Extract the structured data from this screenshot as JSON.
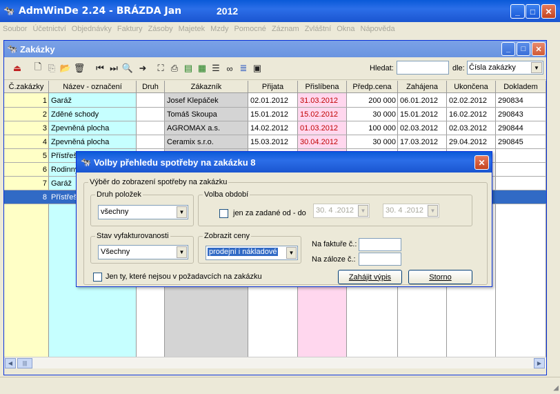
{
  "app": {
    "title": "AdmWinDe 2.24 - BRÁZDA Jan",
    "year": "2012",
    "icon": "app-icon"
  },
  "menu": [
    "Soubor",
    "Účetnictví",
    "Objednávky",
    "Faktury",
    "Zásoby",
    "Majetek",
    "Mzdy",
    "Pomocné",
    "Záznam",
    "Zvláštní",
    "Okna",
    "Nápověda"
  ],
  "child": {
    "title": "Zakázky",
    "search_label": "Hledat:",
    "search_value": "",
    "by_label": "dle:",
    "by_value": "Čísla zakázky"
  },
  "toolbar_icons": [
    "exit-icon",
    "new-icon",
    "copy-icon",
    "open-icon",
    "delete-icon",
    "first-icon",
    "last-icon",
    "find-icon",
    "next-icon",
    "select-icon",
    "print-icon",
    "export-icon",
    "excel-icon",
    "list-icon",
    "binoculars-icon",
    "tree-icon",
    "report-icon"
  ],
  "table": {
    "columns": [
      "Č.zakázky",
      "Název - označení",
      "Druh",
      "Zákazník",
      "Přijata",
      "Přislíbena",
      "Předp.cena",
      "Zahájena",
      "Ukončena",
      "Dokladem"
    ],
    "rows": [
      [
        "1",
        "Garáž",
        "",
        "Josef Klepáček",
        "02.01.2012",
        "31.03.2012",
        "200 000",
        "06.01.2012",
        "02.02.2012",
        "290834"
      ],
      [
        "2",
        "Zděné schody",
        "",
        "Tomáš Skoupa",
        "15.01.2012",
        "15.02.2012",
        "30 000",
        "15.01.2012",
        "16.02.2012",
        "290843"
      ],
      [
        "3",
        "Zpevněná plocha",
        "",
        "AGROMAX a.s.",
        "14.02.2012",
        "01.03.2012",
        "100 000",
        "02.03.2012",
        "02.03.2012",
        "290844"
      ],
      [
        "4",
        "Zpevněná plocha",
        "",
        "Ceramix s.r.o.",
        "15.03.2012",
        "30.04.2012",
        "30 000",
        "17.03.2012",
        "29.04.2012",
        "290845"
      ],
      [
        "5",
        "Přístřeš",
        "",
        "",
        "",
        "",
        "",
        "",
        "",
        ""
      ],
      [
        "6",
        "Rodinný",
        "",
        "",
        "",
        "",
        "",
        "",
        "",
        ""
      ],
      [
        "7",
        "Garáž",
        "",
        "",
        "",
        "",
        "",
        "",
        "",
        ""
      ],
      [
        "8",
        "Přístřeš",
        "",
        "",
        "",
        "",
        "",
        "",
        "",
        ""
      ]
    ],
    "selected_row": 8
  },
  "dialog": {
    "title": "Volby přehledu spotřeby na zakázku 8",
    "group_main": "Výběr do zobrazení spotřeby na zakázku",
    "group_druh": "Druh položek",
    "druh_value": "všechny",
    "group_obdobi": "Volba období",
    "obdobi_check_label": "jen za zadané od - do",
    "date_from": "30. 4 .2012",
    "date_to": "30. 4 .2012",
    "group_stav": "Stav vyfakturovanosti",
    "stav_value": "Všechny",
    "group_ceny": "Zobrazit ceny",
    "ceny_value": "prodejní i nákladové",
    "faktura_label": "Na faktuře č.:",
    "zaloha_label": "Na záloze č.:",
    "only_label": "Jen ty, které nejsou v požadavcích na zakázku",
    "start_button": "Zahájit výpis",
    "cancel_button": "Storno"
  },
  "colors": {
    "cyan_col": "#c6ffff",
    "yellow_col": "#ffffc6",
    "gray_col": "#d4d4d4",
    "pink_col": "#ffd7ee",
    "selection": "#316ac5"
  }
}
